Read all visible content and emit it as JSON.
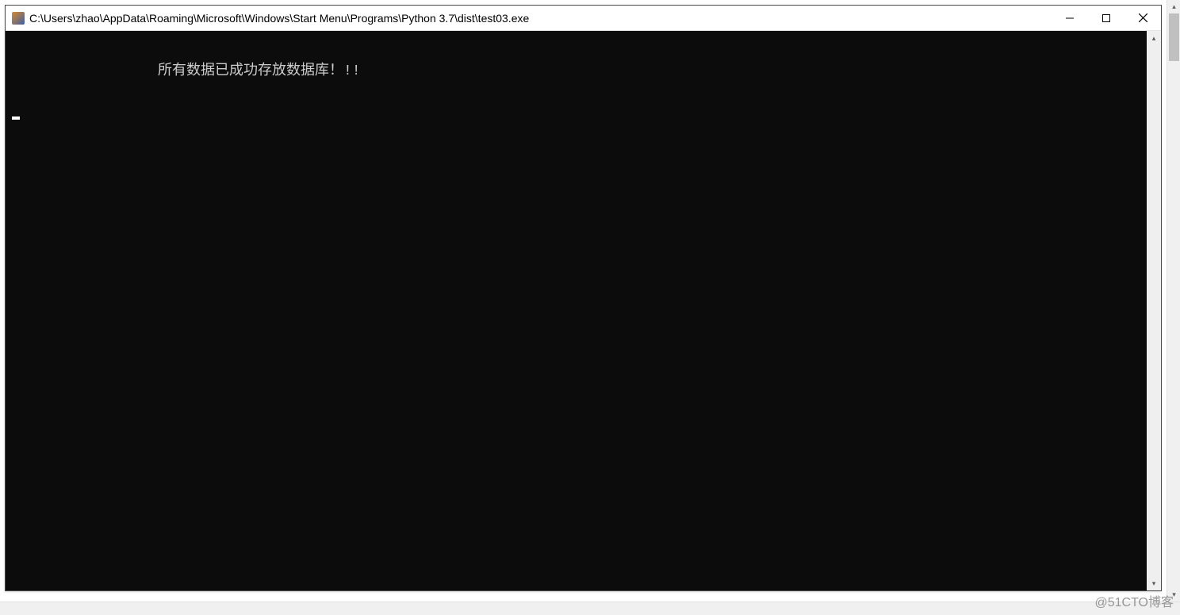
{
  "window": {
    "title": "C:\\Users\\zhao\\AppData\\Roaming\\Microsoft\\Windows\\Start Menu\\Programs\\Python 3.7\\dist\\test03.exe"
  },
  "console": {
    "output_line": "所有数据已成功存放数据库！!!"
  },
  "watermark": "@51CTO博客"
}
